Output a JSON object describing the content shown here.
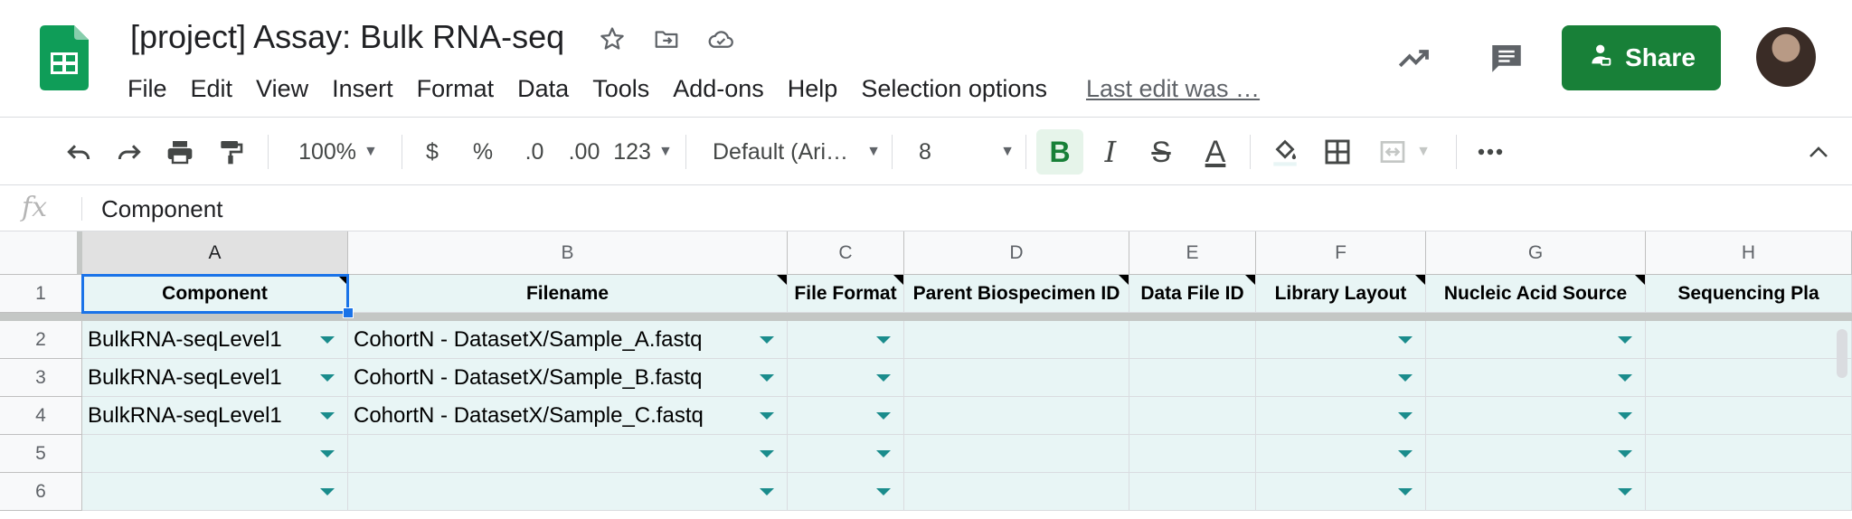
{
  "header": {
    "title": "[project] Assay: Bulk RNA-seq",
    "menu": [
      "File",
      "Edit",
      "View",
      "Insert",
      "Format",
      "Data",
      "Tools",
      "Add-ons",
      "Help",
      "Selection options"
    ],
    "last_edit": "Last edit was …",
    "share_label": "Share",
    "icons": {
      "logo": "sheets-logo-icon",
      "star": "star-icon",
      "move": "move-to-folder-icon",
      "cloud": "cloud-saved-icon",
      "activity": "trending-up-icon",
      "comments": "comment-icon",
      "share": "person-add-icon"
    },
    "colors": {
      "brand_green": "#188038",
      "logo_green": "#0f9d58"
    }
  },
  "toolbar": {
    "zoom": "100%",
    "currency": "$",
    "percent": "%",
    "decrease_decimals": ".0",
    "increase_decimals": ".00",
    "more_formats": "123",
    "font": "Default (Ari…",
    "font_size": "8",
    "bold": "B",
    "italic": "I",
    "strikethrough": "S",
    "text_color": "A",
    "icons": [
      "undo-icon",
      "redo-icon",
      "print-icon",
      "paint-format-icon",
      "fill-color-icon",
      "borders-icon",
      "merge-cells-icon",
      "more-icon",
      "collapse-icon"
    ]
  },
  "formula_bar": {
    "fx": "fx",
    "value": "Component"
  },
  "grid": {
    "columns": [
      "A",
      "B",
      "C",
      "D",
      "E",
      "F",
      "G",
      "H"
    ],
    "rows": [
      "1",
      "2",
      "3",
      "4",
      "5",
      "6"
    ],
    "header_row": [
      "Component",
      "Filename",
      "File Format",
      "Parent Biospecimen ID",
      "Data File ID",
      "Library Layout",
      "Nucleic Acid Source",
      "Sequencing Pla"
    ],
    "data": [
      [
        "BulkRNA-seqLevel1",
        "CohortN - DatasetX/Sample_A.fastq",
        "",
        "",
        "",
        "",
        "",
        ""
      ],
      [
        "BulkRNA-seqLevel1",
        "CohortN - DatasetX/Sample_B.fastq",
        "",
        "",
        "",
        "",
        "",
        ""
      ],
      [
        "BulkRNA-seqLevel1",
        "CohortN - DatasetX/Sample_C.fastq",
        "",
        "",
        "",
        "",
        "",
        ""
      ],
      [
        "",
        "",
        "",
        "",
        "",
        "",
        "",
        ""
      ],
      [
        "",
        "",
        "",
        "",
        "",
        "",
        "",
        ""
      ]
    ],
    "selected_cell": "A1",
    "colors": {
      "cell_fill": "#e8f5f5",
      "selection": "#1a73e8",
      "dropdown": "#1a8c8c"
    }
  }
}
